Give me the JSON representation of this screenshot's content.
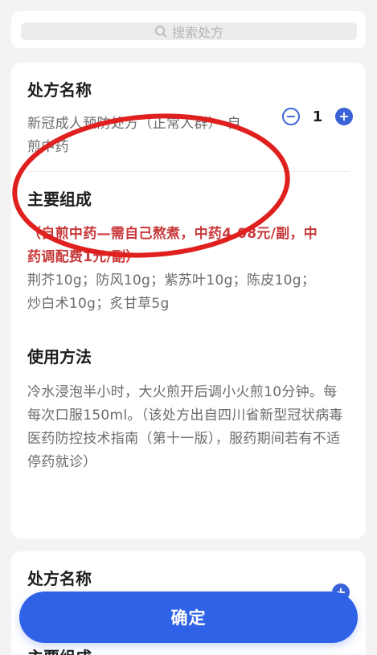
{
  "search": {
    "placeholder": "搜索处方"
  },
  "prescription1": {
    "title_label": "处方名称",
    "name_line1": "新冠成人预防处方（正常人群）-自",
    "name_line2": "煎中药",
    "quantity": "1",
    "minus_label": "−",
    "plus_label": "+",
    "composition_label": "主要组成",
    "note_line1": "（自煎中药—需自己熬煮，中药4.08元/副，中",
    "note_line2": "药调配费1元/副）",
    "ingredients_line1": "荆芥10g；防风10g；紫苏叶10g；陈皮10g；",
    "ingredients_line2": "炒白术10g；炙甘草5g",
    "usage_label": "使用方法",
    "usage_line1": "冷水浸泡半小时，大火煎开后调小火煎10分钟。每",
    "usage_line2": "每次口服150ml。（该处方出自四川省新型冠状病毒",
    "usage_line3": "医药防控技术指南（第十一版），服药期间若有不适",
    "usage_line4": "停药就诊）"
  },
  "prescription2": {
    "title_label": "处方名称",
    "composition_label": "主要组成",
    "plus_label": "+"
  },
  "footer": {
    "confirm_label": "确定"
  },
  "colors": {
    "accent": "#2f62e6",
    "note_red": "#c8393b",
    "annotation_red": "#e0201e"
  }
}
